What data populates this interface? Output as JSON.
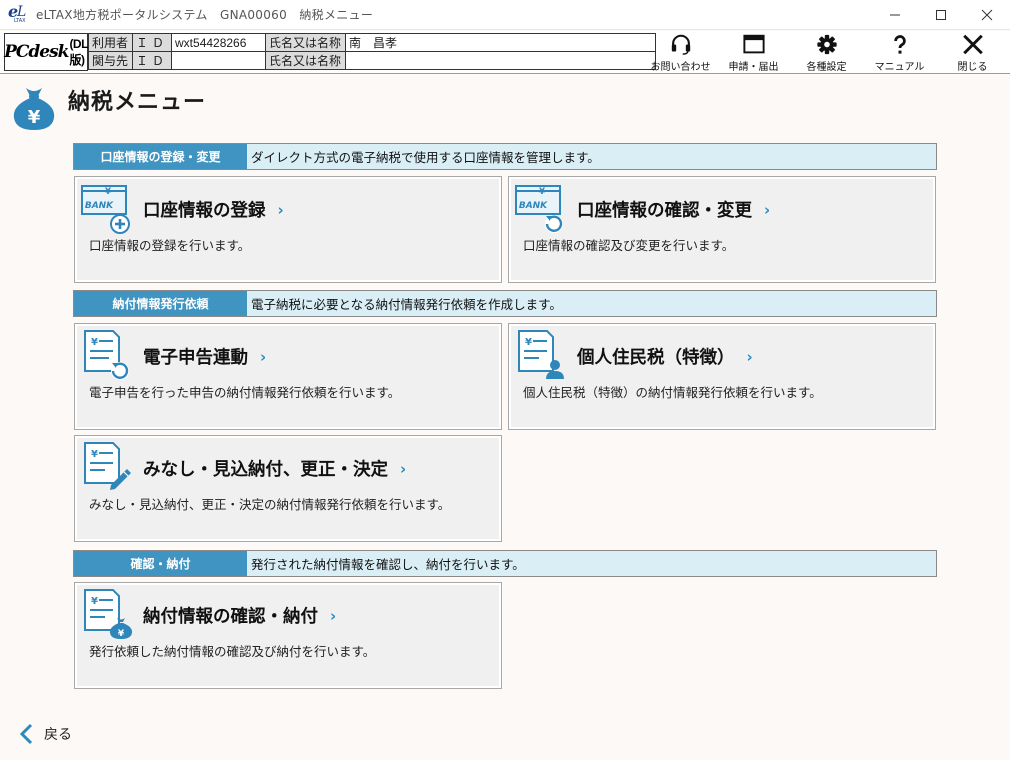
{
  "window": {
    "title": "eLTAX地方税ポータルシステム　GNA00060　納税メニュー",
    "logo_small": "LTAX"
  },
  "brand": {
    "name": "PCdesk",
    "edition": "(DL版)"
  },
  "user_info": {
    "row1": {
      "role": "利用者",
      "id_label": "ＩＤ",
      "id_value": "wxt54428266",
      "name_label": "氏名又は名称",
      "name_value": "南　昌孝"
    },
    "row2": {
      "role": "関与先",
      "id_label": "ＩＤ",
      "id_value": "",
      "name_label": "氏名又は名称",
      "name_value": ""
    }
  },
  "toolbar": {
    "contact": "お問い合わせ",
    "apply": "申請・届出",
    "settings": "各種設定",
    "manual": "マニュアル",
    "close": "閉じる"
  },
  "page": {
    "title": "納税メニュー"
  },
  "sections": [
    {
      "label": "口座情報の登録・変更",
      "desc": "ダイレクト方式の電子納税で使用する口座情報を管理します。",
      "cards": [
        {
          "title": "口座情報の登録",
          "desc": "口座情報の登録を行います。",
          "icon": "bank-add-icon"
        },
        {
          "title": "口座情報の確認・変更",
          "desc": "口座情報の確認及び変更を行います。",
          "icon": "bank-refresh-icon"
        }
      ]
    },
    {
      "label": "納付情報発行依頼",
      "desc": "電子納税に必要となる納付情報発行依頼を作成します。",
      "cards": [
        {
          "title": "電子申告連動",
          "desc": "電子申告を行った申告の納付情報発行依頼を行います。",
          "icon": "doc-sync-icon"
        },
        {
          "title": "個人住民税（特徴）",
          "desc": "個人住民税（特徴）の納付情報発行依頼を行います。",
          "icon": "doc-person-icon"
        },
        {
          "title": "みなし・見込納付、更正・決定",
          "desc": "みなし・見込納付、更正・決定の納付情報発行依頼を行います。",
          "icon": "doc-pen-icon"
        }
      ]
    },
    {
      "label": "確認・納付",
      "desc": "発行された納付情報を確認し、納付を行います。",
      "cards": [
        {
          "title": "納付情報の確認・納付",
          "desc": "発行依頼した納付情報の確認及び納付を行います。",
          "icon": "doc-moneybag-icon"
        }
      ]
    }
  ],
  "chevron": "›",
  "back": "戻る",
  "icon_glyphs": {
    "yen": "¥",
    "bank": "BANK"
  },
  "colors": {
    "accent": "#3f94c1",
    "section_bg": "#daeef6",
    "chevron": "#2a8bc0"
  }
}
